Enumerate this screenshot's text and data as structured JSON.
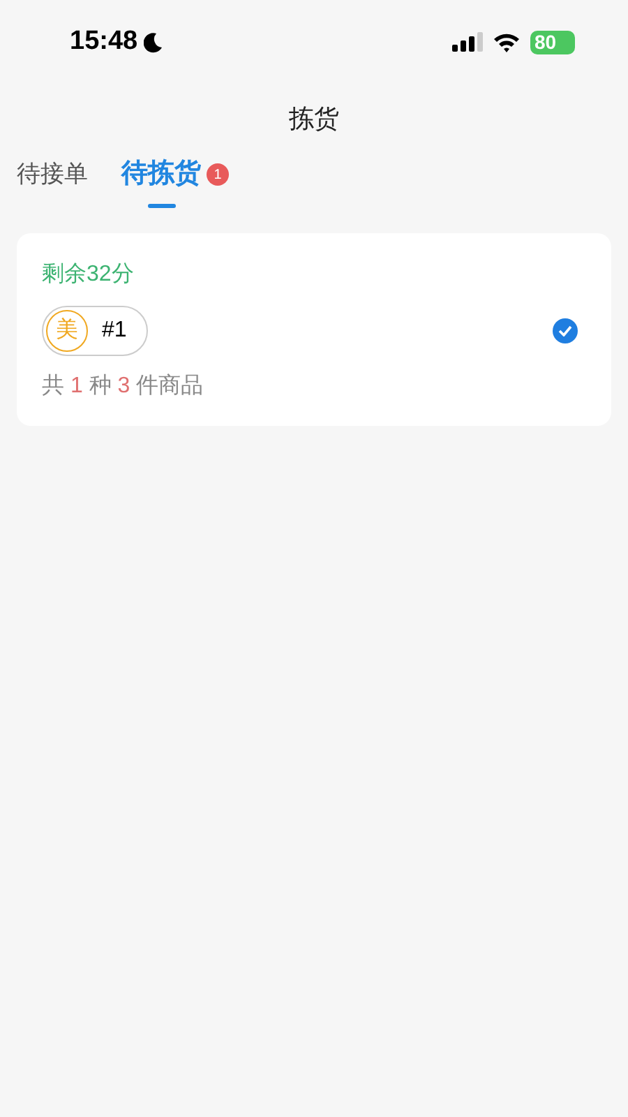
{
  "status_bar": {
    "time": "15:48",
    "battery": "80"
  },
  "title": "拣货",
  "tabs": [
    {
      "label": "待接单",
      "selected": false
    },
    {
      "label": "待拣货",
      "selected": true,
      "badge": "1"
    }
  ],
  "orders": [
    {
      "remaining": "剩余32分",
      "platform_badge": "美",
      "number": "#1",
      "checked": true,
      "summary": [
        {
          "text": "共 ",
          "kind": "plain"
        },
        {
          "text": "1",
          "kind": "count"
        },
        {
          "text": " 种 ",
          "kind": "plain"
        },
        {
          "text": "3",
          "kind": "count"
        },
        {
          "text": " 件商品",
          "kind": "plain"
        }
      ]
    }
  ]
}
